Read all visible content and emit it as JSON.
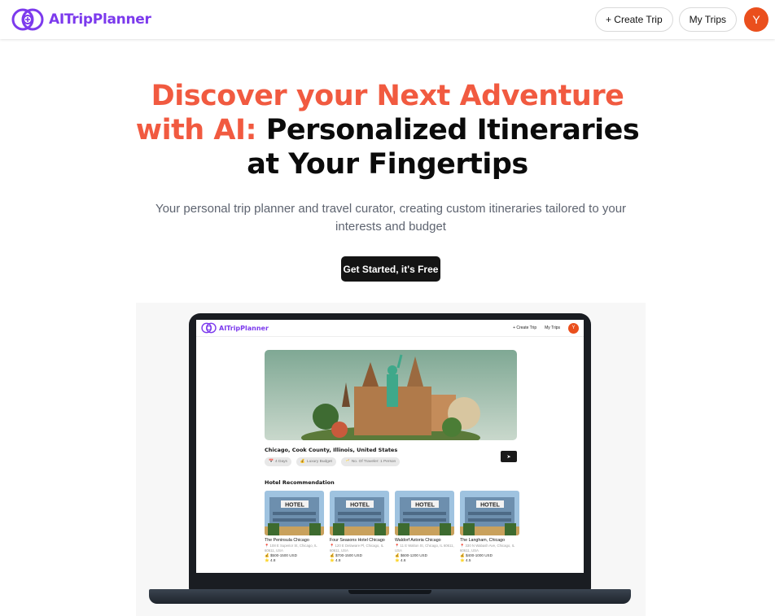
{
  "header": {
    "brand": "AITripPlanner",
    "create_trip_label": "+ Create Trip",
    "my_trips_label": "My Trips",
    "avatar_initial": "Y"
  },
  "hero": {
    "title_accent_line1": "Discover your Next Adventure",
    "title_accent_line2": "with AI:",
    "title_dark_line2": "Personalized Itineraries",
    "title_dark_line3": "at Your Fingertips",
    "subtitle_line1": "Your personal trip planner and travel curator, creating custom itineraries tailored to your",
    "subtitle_line2": "interests and budget",
    "cta_label": "Get Started, it's Free"
  },
  "mockup": {
    "brand": "AITripPlanner",
    "create_trip_label": "+ Create Trip",
    "my_trips_label": "My Trips",
    "avatar_initial": "Y",
    "location": "Chicago, Cook County, Illinois, United States",
    "chips": [
      {
        "icon": "📅",
        "label": "4 Days"
      },
      {
        "icon": "💰",
        "label": "Luxury Budget"
      },
      {
        "icon": "🥂",
        "label": "No. Of Traveler: 1 Person"
      }
    ],
    "section_title": "Hotel Recommendation",
    "hotels": [
      {
        "name": "The Peninsula Chicago",
        "address": "📍 108 E Superior St, Chicago, IL 60611, USA",
        "price": "💰 $500-1500 USD",
        "rating": "⭐ 4.8"
      },
      {
        "name": "Four Seasons Hotel Chicago",
        "address": "📍 120 E Delaware Pl, Chicago, IL 60611, USA",
        "price": "💰 $700-1500 USD",
        "rating": "⭐ 4.8"
      },
      {
        "name": "Waldorf Astoria Chicago",
        "address": "📍 11 E Walton St, Chicago, IL 60611, USA",
        "price": "💰 $600-1200 USD",
        "rating": "⭐ 4.6"
      },
      {
        "name": "The Langham, Chicago",
        "address": "📍 330 N Wabash Ave, Chicago, IL 60611, USA",
        "price": "💰 $400-1000 USD",
        "rating": "⭐ 4.5"
      }
    ],
    "hotel_sign": "HOTEL"
  },
  "colors": {
    "brand_purple": "#7c3aed",
    "accent_coral": "#f15a40",
    "avatar_orange": "#ea4f1d",
    "cta_black": "#141414"
  }
}
